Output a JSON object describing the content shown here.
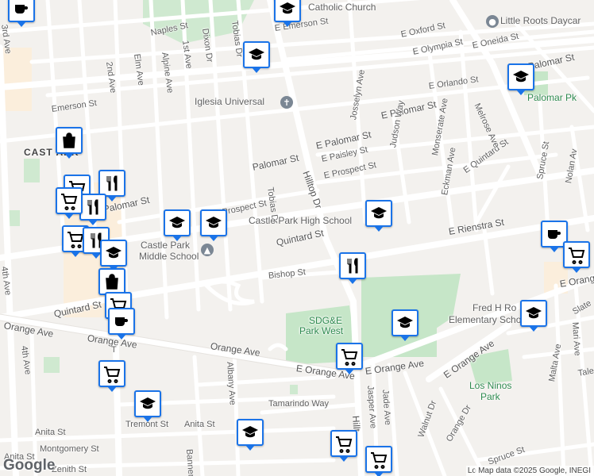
{
  "map": {
    "streets": {
      "naples": "Naples St",
      "e_emerson": "E Emerson St",
      "e_oxford": "E Oxford St",
      "e_olympia": "E Olympia St",
      "e_oneida": "E Oneida St",
      "emerson": "Emerson St",
      "e_orlando": "E Orlando St",
      "palomar_top": "Palomar St",
      "e_palomar_mid": "E Palomar St",
      "palomar_w": "Palomar St",
      "e_palomar_w": "E Palomar St",
      "palomar_left": "Palomar St",
      "e_paisley": "E Paisley St",
      "e_prospect": "E Prospect St",
      "prospect": "Prospect St",
      "quintard": "Quintard St",
      "quintard_w": "Quintard St",
      "e_quintard": "E Quintard St",
      "e_rienstra": "E Rienstra St",
      "bishop": "Bishop St",
      "orange_w": "Orange Ave",
      "orange_mid": "Orange Ave",
      "orange_e": "Orange Ave",
      "e_orange": "E Orange Ave",
      "e_orange_se": "E Orange Ave",
      "e_orange_right": "E Orange",
      "anita_w": "Anita St",
      "anita": "Anita St",
      "tamarindo": "Tamarindo Way",
      "tremont": "Tremont St",
      "montgomery": "Montgomery St",
      "zenith": "Zenith St",
      "second": "2nd Ave",
      "first": "1st Ave",
      "elm": "Elm Ave",
      "alpine": "Alpine Ave",
      "dixon": "Dixon Dr",
      "tobias_n": "Tobias Dr",
      "tobias_s": "Tobias Dr",
      "hilltop": "Hilltop Dr",
      "hilltop_s": "Hillt",
      "josselyn": "Josselyn Ave",
      "judson": "Judson Way",
      "monserate": "Monserate Ave",
      "melrose": "Melrose Ave",
      "eckman": "Eckman Ave",
      "spruce": "Spruce St",
      "nolan": "Nolan Av",
      "third": "3rd Ave",
      "fourth": "4th Ave",
      "fourth_s": "4th Ave",
      "albany": "Albany Ave",
      "jasper": "Jasper Ave",
      "jade": "Jade Ave",
      "walnut": "Walnut Dr",
      "orange_dr": "Orange Dr",
      "spruce_s": "Spruce St",
      "malta": "Malta Ave",
      "mari": "Mari Ave",
      "slate": "Slate",
      "tale": "Tale",
      "banner": "Banner Av",
      "sixth": "Ave",
      "t_ave": "T"
    },
    "places": {
      "catholic_church": "Catholic Church",
      "little_roots": "Little Roots Daycar",
      "iglesia": "Iglesia Universal",
      "palomar_pk": "Palomar Pk",
      "castle_park_high": "Castle Park High School",
      "castle_park_middle_1": "Castle Park",
      "castle_park_middle_2": "Middle School",
      "sdge_1": "SDG&E",
      "sdge_2": "Park West",
      "fred_h_1": "Fred H Ro",
      "fred_h_2": "Elementary Scho",
      "los_ninos_1": "Los Ninos",
      "los_ninos_2": "Park",
      "area_castle_park": "CAST    ARK"
    },
    "attribution": "Map data ©2025 Google, INEGI",
    "lo": "Lo",
    "logo": "Google"
  }
}
